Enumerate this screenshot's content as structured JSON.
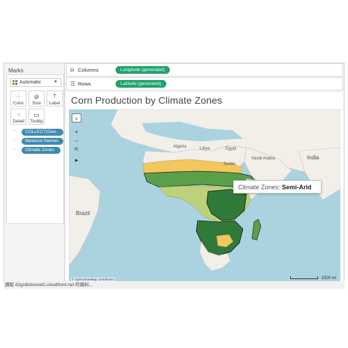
{
  "marks": {
    "title": "Marks",
    "mark_type": "Automatic",
    "buttons": [
      {
        "label": "Color",
        "icon": "color-dots-icon"
      },
      {
        "label": "Size",
        "icon": "size-icon"
      },
      {
        "label": "Label",
        "icon": "label-icon"
      },
      {
        "label": "Detail",
        "icon": "detail-icon"
      },
      {
        "label": "Tooltip",
        "icon": "tooltip-icon"
      }
    ],
    "fields": [
      {
        "label": "COLLECT(Geo..",
        "icon": "detail-icon",
        "color": "#3e8bb0"
      },
      {
        "label": "Measure Names",
        "icon": "color-dots-icon",
        "color": "#3e8bb0"
      },
      {
        "label": "Climate Zones",
        "icon": "color-dots-icon",
        "color": "#3e8bb0"
      }
    ]
  },
  "shelves": {
    "columns": {
      "label": "Columns",
      "pill": "Longitude (generated)"
    },
    "rows": {
      "label": "Rows",
      "pill": "Latitude (generated)"
    }
  },
  "sheet": {
    "title": "Corn Production by Climate Zones"
  },
  "map": {
    "labels": {
      "libya": "Libya",
      "egypt": "Egypt",
      "saudi": "Saudi Arabia",
      "india": "India",
      "brazil": "Brazil",
      "e1": "Sudan",
      "alg": "Algeria"
    },
    "attribution": "© OpenStreetMap contributors",
    "scale": "1500 mi",
    "colors": {
      "ocean": "#aad3df",
      "land": "#f2efe9",
      "arid": "#f2c75c",
      "semi_arid": "#bcd17a",
      "tropical": "#5a9f4a",
      "humid": "#2f7a3a"
    }
  },
  "tooltip": {
    "label": "Climate Zones:",
    "value": "Semi-Arid"
  },
  "status_bar": "讀取 d2grdkdsxowl2.cloudfront.net 的資料..."
}
